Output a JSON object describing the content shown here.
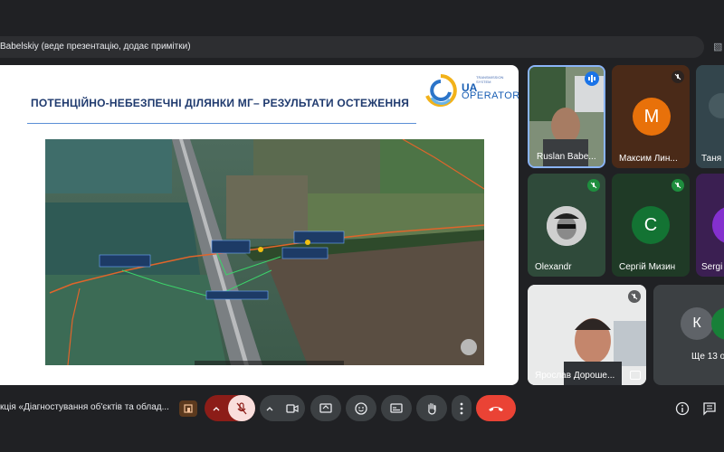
{
  "header": {
    "presenting_label": "Babelskiy (веде презентацію, додає примітки)"
  },
  "slide": {
    "title": "ПОТЕНЦІЙНО-НЕБЕЗПЕЧНІ ДІЛЯНКИ МГ– РЕЗУЛЬТАТИ ОСТЕЖЕННЯ",
    "logo_small_text": "TRANSMISSION SYSTEM",
    "logo_ua": "UA",
    "logo_operator": "OPERATOR"
  },
  "participants": [
    {
      "name": "Ruslan Babe...",
      "type": "video",
      "speaking": true
    },
    {
      "name": "Максим Лин...",
      "initial": "М",
      "color": "#e8710a",
      "muted": true
    },
    {
      "name": "Таня Б",
      "type": "video",
      "muted": false
    },
    {
      "name": "Olexandr",
      "type": "avatar-photo",
      "muted": true
    },
    {
      "name": "Сергій Мизин",
      "initial": "С",
      "color": "#137333",
      "muted": true
    },
    {
      "name": "Sergi",
      "initial": "",
      "color": "#8430ce",
      "muted": false
    },
    {
      "name": "Ярослав Дороше...",
      "type": "video",
      "muted": true
    },
    {
      "name": "Ще 13 о",
      "initial": "К",
      "color": "#5f6368"
    }
  ],
  "bottom": {
    "meeting_title": "кція «Діагностування об'єктів та облад..."
  },
  "colors": {
    "background": "#202124",
    "control": "#3c4043",
    "end_call": "#ea4335",
    "mic_off": "#f9dedc",
    "accent": "#1a73e8"
  }
}
